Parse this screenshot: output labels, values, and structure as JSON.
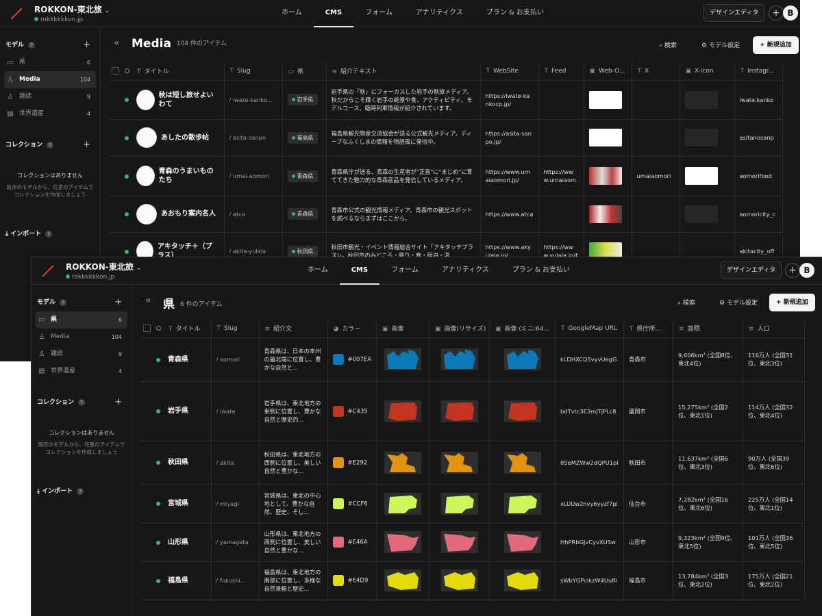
{
  "app": {
    "project_name": "ROKKON-東北旅",
    "project_url": "rokkkkkkon.jp",
    "nav_tabs": [
      "ホーム",
      "CMS",
      "フォーム",
      "アナリティクス",
      "プラン & お支払い"
    ],
    "active_tab": "CMS",
    "design_editor": "デザインエディタ",
    "avatar_letter": "B"
  },
  "sidebar": {
    "models_label": "モデル",
    "models": [
      {
        "label": "県",
        "count": "6",
        "icon": "folder-icon"
      },
      {
        "label": "Media",
        "count": "104",
        "icon": "person-icon"
      },
      {
        "label": "雑誌",
        "count": "9",
        "icon": "person-icon"
      },
      {
        "label": "世界遺産",
        "count": "4",
        "icon": "document-icon"
      }
    ],
    "collections_label": "コレクション",
    "collections_empty_title": "コレクションはありません",
    "collections_empty_desc": "既存のモデルから、任意のアイテムでコレクションを作成しましょう",
    "import_label": "インポート"
  },
  "toolbar": {
    "search": "検索",
    "model_settings": "モデル設定",
    "new_item": "新規追加"
  },
  "back": {
    "title": "Media",
    "count": "104 件のアイテム",
    "columns": [
      "タイトル",
      "Slug",
      "県",
      "紹介テキスト",
      "WebSite",
      "Feed",
      "Web-O...",
      "X",
      "X-icon",
      "Instagr..."
    ],
    "rows": [
      {
        "title": "秋は短し旅せよいわて",
        "slug": "/ iwate-kanko...",
        "pref": "岩手県",
        "desc": "岩手県の「秋」にフォーカスした岩手の秋旅メディア。秋だからこそ輝く岩手の絶景や食、アクティビティ、モデルコース、臨時列車情報が紹介されています。",
        "website": "https://iwate-kankocp.jp/",
        "feed": "",
        "x": "",
        "insta": "iwate.kanko"
      },
      {
        "title": "あしたの散歩帖",
        "slug": "/ asita-sanpo",
        "pref": "福島県",
        "desc": "福島県観光物産交流協会が送る公式観光メディア。ディープなふくしまの情報を物語風に発信中。",
        "website": "https://asita-sanpo.jp/",
        "feed": "",
        "x": "",
        "insta": "asitanosanp"
      },
      {
        "title": "青森のうまいものたち",
        "slug": "/ umai-aomori",
        "pref": "青森県",
        "desc": "青森県庁が送る、青森の生産者が\"正直\"に\"まじめ\"に育ててきた魅力的な青森産品を発信しているメディア。",
        "website": "https://www.umaiaomori.jp/",
        "feed": "https://www.umaiaomori.jp/fe",
        "x": "umaiaomori",
        "insta": "aomorifood"
      },
      {
        "title": "あおもり案内名人",
        "slug": "/ atca",
        "pref": "青森県",
        "desc": "青森市公式の観光情報メディア。青森市の観光スポットを調べるならまずはここから。",
        "website": "https://www.atca",
        "feed": "",
        "x": "",
        "insta": "aomoricity_c"
      },
      {
        "title": "アキタッチ＋（プラス）",
        "slug": "/ akita-yulala",
        "pref": "秋田県",
        "desc": "秋田市観光・イベント情報総合サイト「アキタッチプラス)」。秋田市のみどころ・祭り・食・宿泊・温",
        "website": "https://www.akyulala.jp/",
        "feed": "https://www.yulala.jp/fe",
        "x": "",
        "insta": "akitacity_off"
      }
    ]
  },
  "front": {
    "title": "県",
    "count": "6 件のアイテム",
    "columns": [
      "タイトル",
      "Slug",
      "紹介文",
      "カラー",
      "画像",
      "画像(リサイズ)",
      "画像 (ミニ:64...",
      "GoogleMap URL",
      "県庁所...",
      "面積",
      "人口"
    ],
    "rows": [
      {
        "title": "青森県",
        "slug": "/ aomori",
        "desc": "青森県は、日本の本州の最北端に位置し、豊かな自然と...",
        "color": "#007EA",
        "swatch": "#0a7ab8",
        "gmap": "kLDHXCQ5vyvUegG",
        "capital": "青森市",
        "area": "9,606km² (全国8位、東北4位)",
        "pop": "116万人 (全国31位、東北3位)"
      },
      {
        "title": "岩手県",
        "slug": "/ iwate",
        "desc": "岩手県は、東北地方の東側に位置し、豊かな自然と歴史的...",
        "color": "#C435",
        "swatch": "#c4351f",
        "gmap": "bdTvtc3E3mJTjPLc8",
        "capital": "盛岡市",
        "area": "15,275km² (全国2位、東北1位)",
        "pop": "114万人 (全国32位、東北4位)"
      },
      {
        "title": "秋田県",
        "slug": "/ akita",
        "desc": "秋田県は、東北地方の西側に位置し、美しい自然と豊かな...",
        "color": "#E292",
        "swatch": "#e2920c",
        "gmap": "85eMZWw2dQPU1pl",
        "capital": "秋田市",
        "area": "11,637km² (全国6位、東北3位)",
        "pop": "90万人 (全国39位、東北6位)"
      },
      {
        "title": "宮城県",
        "slug": "/ miyagi",
        "desc": "宮城県は、東北の中心地として、豊かな自然、歴史、そし...",
        "color": "#CCF6",
        "swatch": "#ccf65a",
        "gmap": "xLUUw2hvy6yyzf7pl",
        "capital": "仙台市",
        "area": "7,282km² (全国16位、東北6位)",
        "pop": "225万人 (全国14位、東北1位)"
      },
      {
        "title": "山形県",
        "slug": "/ yamagata",
        "desc": "山形県は、東北地方の西側に位置し、美しい自然と豊かな...",
        "color": "#E46A",
        "swatch": "#e46a7a",
        "gmap": "HhPRbGJvCyvXUSw",
        "capital": "山形市",
        "area": "9,323km² (全国9位、東北5位)",
        "pop": "101万人 (全国36位、東北5位)"
      },
      {
        "title": "福島県",
        "slug": "/ fukushi...",
        "desc": "福島県は、東北地方の南部に位置し、多様な自然景観と歴史...",
        "color": "#E4D9",
        "swatch": "#e4d90c",
        "gmap": "sWbYGPcikzW4UuRl",
        "capital": "福島市",
        "area": "13,784km² (全国3位、東北2位)",
        "pop": "175万人 (全国21位、東北2位)"
      }
    ]
  }
}
